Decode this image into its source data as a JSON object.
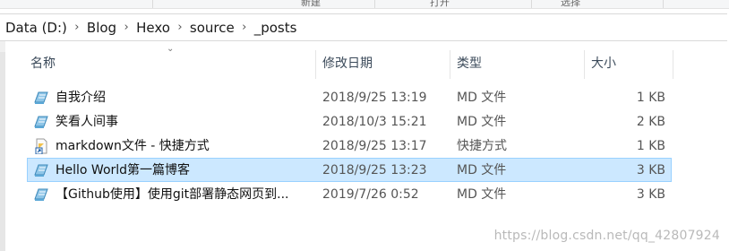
{
  "ribbon": {
    "labels": [
      "新建",
      "打开",
      "选择"
    ]
  },
  "breadcrumb": [
    "Data (D:)",
    "Blog",
    "Hexo",
    "source",
    "_posts"
  ],
  "columns": {
    "name": "名称",
    "date": "修改日期",
    "type": "类型",
    "size": "大小"
  },
  "files": [
    {
      "name": "自我介绍",
      "date": "2018/9/25 13:19",
      "type": "MD 文件",
      "size": "1 KB",
      "icon": "md-file-icon",
      "selected": false
    },
    {
      "name": "笑看人间事",
      "date": "2018/10/3 15:21",
      "type": "MD 文件",
      "size": "2 KB",
      "icon": "md-file-icon",
      "selected": false
    },
    {
      "name": "markdown文件 - 快捷方式",
      "date": "2018/9/25 13:17",
      "type": "快捷方式",
      "size": "1 KB",
      "icon": "shortcut-file-icon",
      "selected": false
    },
    {
      "name": "Hello World第一篇博客",
      "date": "2018/9/25 13:23",
      "type": "MD 文件",
      "size": "3 KB",
      "icon": "md-file-icon",
      "selected": true
    },
    {
      "name": "【Github使用】使用git部署静态网页到...",
      "date": "2019/7/26 0:52",
      "type": "MD 文件",
      "size": "3 KB",
      "icon": "md-file-icon",
      "selected": false
    }
  ],
  "watermark": "https://blog.csdn.net/qq_42807924",
  "colors": {
    "selection_bg": "#cce8ff",
    "selection_border": "#99d1ff"
  }
}
